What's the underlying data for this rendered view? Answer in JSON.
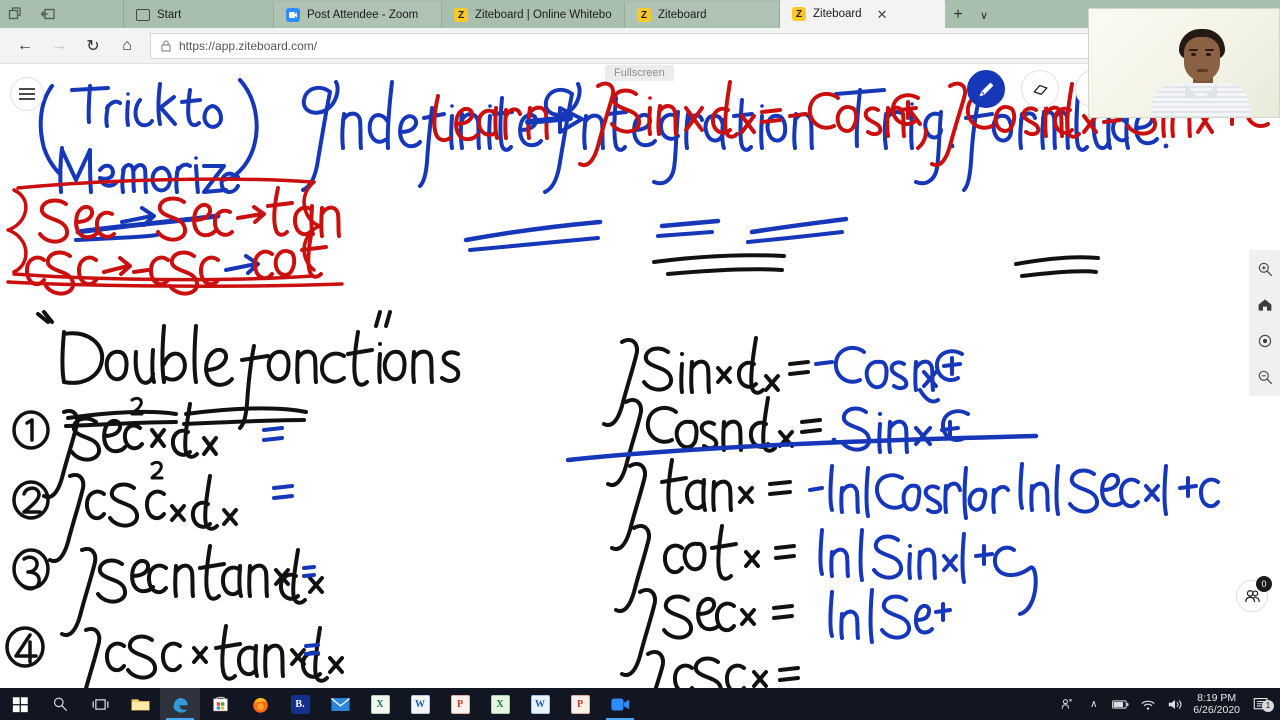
{
  "window": {
    "controls": [
      {
        "name": "restore-window-icon"
      },
      {
        "name": "minimize-window-icon"
      }
    ]
  },
  "tabs": [
    {
      "label": "Start",
      "favicon": "start-icon",
      "active": false,
      "closable": false
    },
    {
      "label": "Post Attendee - Zoom",
      "favicon": "zoom-icon",
      "active": false,
      "closable": false
    },
    {
      "label": "Ziteboard | Online Whitebo",
      "favicon": "ziteboard-icon",
      "active": false,
      "closable": false
    },
    {
      "label": "Ziteboard",
      "favicon": "ziteboard-icon",
      "active": false,
      "closable": false
    },
    {
      "label": "Ziteboard",
      "favicon": "ziteboard-icon",
      "active": true,
      "closable": true
    }
  ],
  "tabbar": {
    "new_tab_label": "+",
    "tab_list_label": "∨",
    "close_label": "✕"
  },
  "navbar": {
    "back_label": "←",
    "forward_label": "→",
    "refresh_label": "↻",
    "home_label": "⌂",
    "url_prefix": "https://",
    "url_domain": "app.ziteboard.com",
    "url_suffix": "/",
    "url_full": "https://app.ziteboard.com/",
    "lock_label": "▫",
    "reading_view_name": "reading-view-icon"
  },
  "overlay": {
    "fullscreen_tooltip": "Fullscreen"
  },
  "whiteboard": {
    "menu_name": "hamburger-menu",
    "tools": [
      {
        "name": "pen-tool",
        "label": "Pen",
        "active": true
      },
      {
        "name": "eraser-tool",
        "label": "Eraser",
        "active": false
      },
      {
        "name": "text-tool",
        "label": "Text",
        "active": false
      }
    ],
    "zoom_rail": [
      {
        "name": "zoom-in-icon",
        "label": "Zoom in"
      },
      {
        "name": "home-icon",
        "label": "Reset view"
      },
      {
        "name": "center-icon",
        "label": "Center"
      },
      {
        "name": "zoom-out-icon",
        "label": "Zoom out"
      }
    ],
    "participants": {
      "name": "participants-button",
      "count": "0"
    },
    "colors": {
      "blue_ink": "#1537b8",
      "red_ink": "#c9100e",
      "black_ink": "#111111",
      "accent": "#1537b8"
    },
    "content": {
      "memorize_note": "( Trick to Memorize )",
      "title": "Indefinite Integration Trig. formulae.",
      "red_box": {
        "line1": "Sec → Sec → tan",
        "line2": "csc → -csc → cot"
      },
      "learn_label": "Learn",
      "learn_formula_1": "∫ Sinx dx = - Cosx + C ,",
      "learn_formula_2": "∫ Cosx dx = Sinx + C",
      "double_functions_heading": "\" Double functions \"",
      "left_list": [
        {
          "number": "1",
          "expression": "∫ sec²x dx",
          "equals": "="
        },
        {
          "number": "2",
          "expression": "∫ csc²x dx",
          "equals": "="
        },
        {
          "number": "3",
          "expression": "∫ Secx tanx dx",
          "equals": "="
        },
        {
          "number": "4",
          "expression": "∫ cscx tanx dx",
          "equals": "="
        }
      ],
      "right_list": [
        {
          "lhs": "∫ Sinx dx",
          "eq": "=",
          "rhs": "- Cosx + C"
        },
        {
          "lhs": "∫ Cosx dx",
          "eq": "=",
          "rhs": "Sinx + C"
        },
        {
          "lhs": "∫ tanx",
          "eq": "=",
          "rhs": "-ln| Cosx| or ln| Secx| + c"
        },
        {
          "lhs": "∫ cotx",
          "eq": "=",
          "rhs": "ln | Sinx| + c"
        },
        {
          "lhs": "∫ secx",
          "eq": "=",
          "rhs": "ln | Se +"
        },
        {
          "lhs": "∫ cscx",
          "eq": "=",
          "rhs": ""
        }
      ]
    }
  },
  "webcam": {
    "name": "presenter-video"
  },
  "taskbar": {
    "items": [
      {
        "name": "start-button",
        "label": "Start"
      },
      {
        "name": "search-button",
        "label": "Search"
      },
      {
        "name": "task-view-button",
        "label": "Task View"
      },
      {
        "name": "file-explorer-button",
        "label": "File Explorer"
      },
      {
        "name": "edge-button",
        "label": "Microsoft Edge"
      },
      {
        "name": "microsoft-store-button",
        "label": "Microsoft Store"
      },
      {
        "name": "firefox-button",
        "label": "Firefox"
      },
      {
        "name": "b-app-button",
        "label": "B."
      },
      {
        "name": "mail-button",
        "label": "Mail"
      },
      {
        "name": "excel-green-button",
        "label": "X"
      },
      {
        "name": "word-doc-button",
        "label": "W"
      },
      {
        "name": "publisher-button",
        "label": "P"
      },
      {
        "name": "excel-button",
        "label": "X"
      },
      {
        "name": "word-button",
        "label": "W"
      },
      {
        "name": "powerpoint-button",
        "label": "P"
      },
      {
        "name": "zoom-app-button",
        "label": "Zoom"
      }
    ],
    "tray": {
      "people_label": "People",
      "overflow_label": "∧",
      "battery_label": "Battery",
      "wifi_label": "Network",
      "volume_label": "Volume",
      "time": "8:19 PM",
      "date": "6/26/2020",
      "notification_count": "1"
    }
  }
}
